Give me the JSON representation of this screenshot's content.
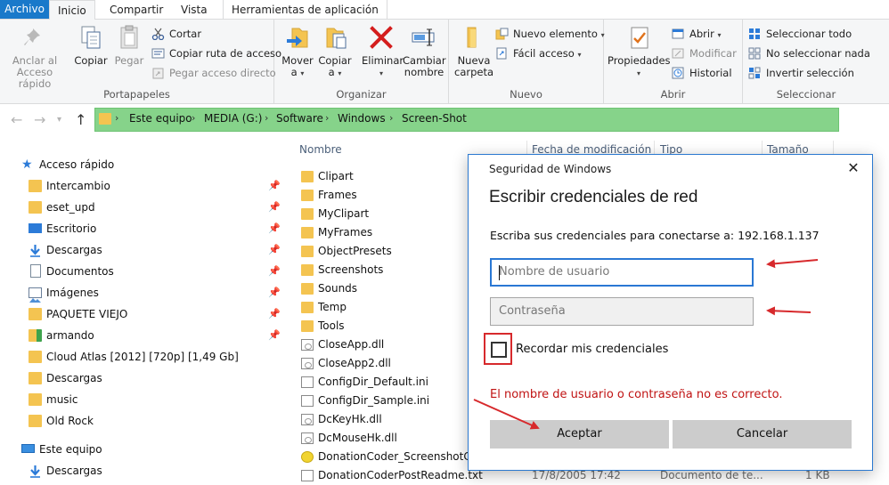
{
  "ribbon_tabs": [
    "Archivo",
    "Inicio",
    "Compartir",
    "Vista",
    "Herramientas de aplicación"
  ],
  "groups": {
    "portapapeles": {
      "label": "Portapapeles",
      "anclar": [
        "Anclar al",
        "Acceso rápido"
      ],
      "copiar": "Copiar",
      "pegar": "Pegar",
      "cortar": "Cortar",
      "copiar_ruta": "Copiar ruta de acceso",
      "pegar_acceso": "Pegar acceso directo"
    },
    "organizar": {
      "label": "Organizar",
      "mover": [
        "Mover",
        "a"
      ],
      "copiar": [
        "Copiar",
        "a"
      ],
      "eliminar": "Eliminar",
      "cambiar": [
        "Cambiar",
        "nombre"
      ]
    },
    "nuevo": {
      "label": "Nuevo",
      "nueva_carpeta": [
        "Nueva",
        "carpeta"
      ],
      "nuevo_elemento": "Nuevo elemento",
      "facil_acceso": "Fácil acceso"
    },
    "abrir": {
      "label": "Abrir",
      "propiedades": "Propiedades",
      "abrir": "Abrir",
      "modificar": "Modificar",
      "historial": "Historial"
    },
    "seleccionar": {
      "label": "Seleccionar",
      "todo": "Seleccionar todo",
      "nada": "No seleccionar nada",
      "invertir": "Invertir selección"
    }
  },
  "breadcrumb": [
    "Este equipo",
    "MEDIA (G:)",
    "Software",
    "Windows",
    "Screen-Shot"
  ],
  "sidebar": {
    "quick_access": "Acceso rápido",
    "pinned": [
      {
        "label": "Intercambio",
        "icon": "folder-icon"
      },
      {
        "label": "eset_upd",
        "icon": "folder-icon"
      },
      {
        "label": "Escritorio",
        "icon": "desktop-icon"
      },
      {
        "label": "Descargas",
        "icon": "download-icon"
      },
      {
        "label": "Documentos",
        "icon": "documents-icon"
      },
      {
        "label": "Imágenes",
        "icon": "images-icon"
      },
      {
        "label": "PAQUETE VIEJO",
        "icon": "folder-icon"
      },
      {
        "label": "armando",
        "icon": "green-folder-icon"
      }
    ],
    "recent": [
      "Cloud Atlas [2012] [720p] [1,49 Gb]",
      "Descargas",
      "music",
      "Old Rock"
    ],
    "this_pc": "Este equipo",
    "pc_items": [
      "Descargas"
    ]
  },
  "columns": {
    "name": "Nombre",
    "date": "Fecha de modificación",
    "type": "Tipo",
    "size": "Tamaño"
  },
  "files": [
    {
      "name": "Clipart",
      "kind": "folder"
    },
    {
      "name": "Frames",
      "kind": "folder"
    },
    {
      "name": "MyClipart",
      "kind": "folder"
    },
    {
      "name": "MyFrames",
      "kind": "folder"
    },
    {
      "name": "ObjectPresets",
      "kind": "folder"
    },
    {
      "name": "Screenshots",
      "kind": "folder"
    },
    {
      "name": "Sounds",
      "kind": "folder"
    },
    {
      "name": "Temp",
      "kind": "folder"
    },
    {
      "name": "Tools",
      "kind": "folder"
    },
    {
      "name": "CloseApp.dll",
      "kind": "dll"
    },
    {
      "name": "CloseApp2.dll",
      "kind": "dll"
    },
    {
      "name": "ConfigDir_Default.ini",
      "kind": "ini"
    },
    {
      "name": "ConfigDir_Sample.ini",
      "kind": "ini"
    },
    {
      "name": "DcKeyHk.dll",
      "kind": "dll"
    },
    {
      "name": "DcMouseHk.dll",
      "kind": "dll"
    },
    {
      "name": "DonationCoder_ScreenshotCapt",
      "kind": "exe"
    },
    {
      "name": "DonationCoderPostReadme.txt",
      "kind": "txt",
      "date": "17/8/2005 17:42",
      "type": "Documento de te...",
      "size": "1 KB"
    }
  ],
  "dialog": {
    "caption": "Seguridad de Windows",
    "title": "Escribir credenciales de red",
    "subtitle": "Escriba sus credenciales para conectarse a: 192.168.1.137",
    "username_placeholder": "Nombre de usuario",
    "password_placeholder": "Contraseña",
    "remember": "Recordar mis credenciales",
    "error": "El nombre de usuario o contraseña no es correcto.",
    "ok": "Aceptar",
    "cancel": "Cancelar",
    "close_glyph": "✕"
  },
  "colors": {
    "accent": "#1979ca",
    "address_highlight": "#86d38a",
    "annotation": "#d7292c",
    "error": "#c01313"
  }
}
